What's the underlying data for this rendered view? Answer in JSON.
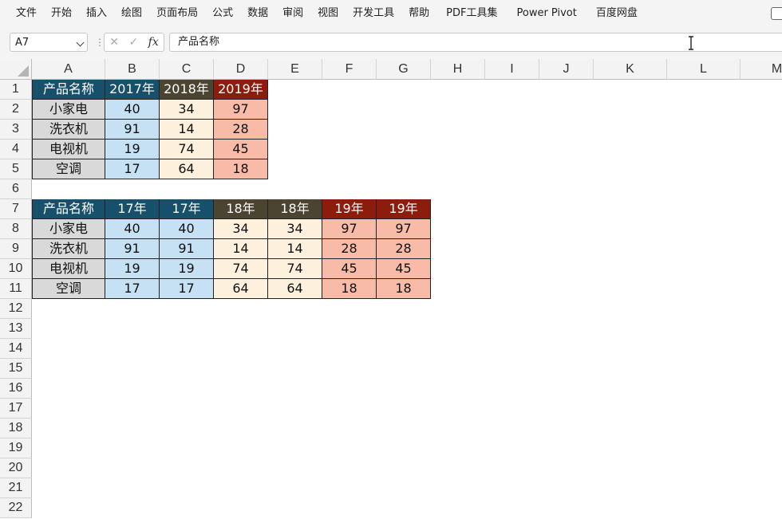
{
  "menu": {
    "items": [
      "文件",
      "开始",
      "插入",
      "绘图",
      "页面布局",
      "公式",
      "数据",
      "审阅",
      "视图",
      "开发工具",
      "帮助",
      "PDF工具集",
      "Power Pivot",
      "百度网盘"
    ]
  },
  "formula_bar": {
    "name_box": "A7",
    "formula": "产品名称",
    "fx_label": "fx"
  },
  "columns": [
    "A",
    "B",
    "C",
    "D",
    "E",
    "F",
    "G",
    "H",
    "I",
    "J",
    "K",
    "L",
    "M"
  ],
  "rows": [
    "1",
    "2",
    "3",
    "4",
    "5",
    "6",
    "7",
    "8",
    "9",
    "10",
    "11",
    "12",
    "13",
    "14",
    "15",
    "16",
    "17",
    "18",
    "19",
    "20",
    "21",
    "22"
  ],
  "colors": {
    "header_2017": "#17506a",
    "header_2018": "#4b4430",
    "header_2019": "#8c1c0c",
    "label_fill": "#d9d9d9",
    "fill_2017": "#c6e0f4",
    "fill_2018": "#fdf0dc",
    "fill_2019": "#f8bba8"
  },
  "table1": {
    "header": [
      "产品名称",
      "2017年",
      "2018年",
      "2019年"
    ],
    "rows": [
      [
        "小家电",
        "40",
        "34",
        "97"
      ],
      [
        "洗衣机",
        "91",
        "14",
        "28"
      ],
      [
        "电视机",
        "19",
        "74",
        "45"
      ],
      [
        "空调",
        "17",
        "64",
        "18"
      ]
    ]
  },
  "table2": {
    "header": [
      "产品名称",
      "17年",
      "17年",
      "18年",
      "18年",
      "19年",
      "19年"
    ],
    "rows": [
      [
        "小家电",
        "40",
        "40",
        "34",
        "34",
        "97",
        "97"
      ],
      [
        "洗衣机",
        "91",
        "91",
        "14",
        "14",
        "28",
        "28"
      ],
      [
        "电视机",
        "19",
        "19",
        "74",
        "74",
        "45",
        "45"
      ],
      [
        "空调",
        "17",
        "17",
        "64",
        "64",
        "18",
        "18"
      ]
    ]
  }
}
